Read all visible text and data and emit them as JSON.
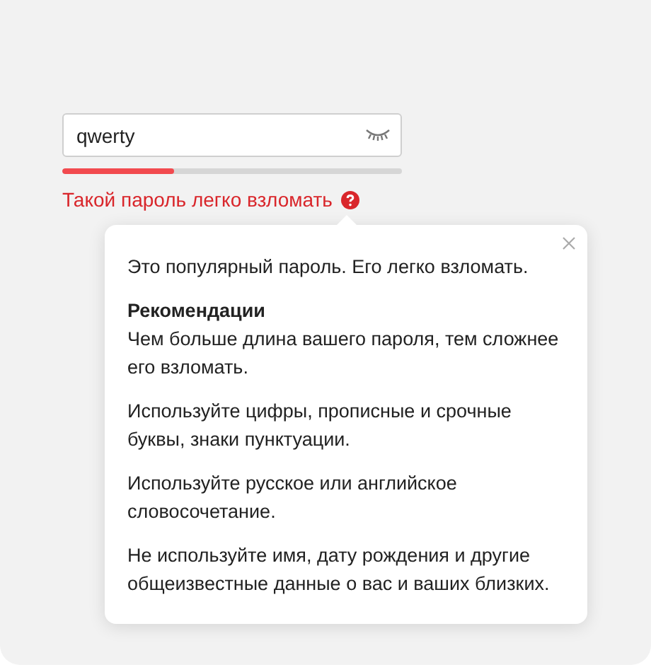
{
  "password_field": {
    "value": "qwerty",
    "masked": false
  },
  "strength_meter": {
    "level": 0.33,
    "color": "#f24a4f"
  },
  "error": {
    "text": "Такой пароль легко взломать"
  },
  "popover": {
    "intro": "Это популярный пароль. Его легко взломать.",
    "heading": "Рекомендации",
    "paragraphs": [
      "Чем больше длина вашего пароля, тем сложнее его взломать.",
      "Используйте цифры, прописные и срочные буквы, знаки пунктуации.",
      "Используйте русское или английское словосочетание.",
      "Не используйте имя, дату рождения и другие общеизвестные данные о вас и ваших близких."
    ]
  }
}
